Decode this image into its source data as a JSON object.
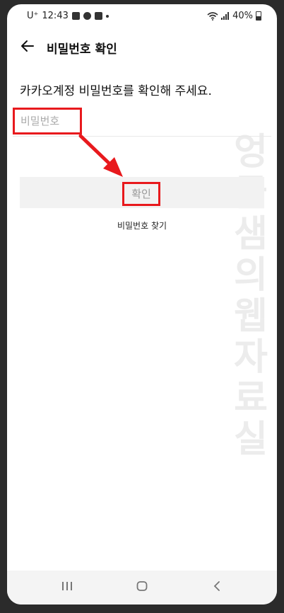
{
  "status_bar": {
    "carrier": "U⁺",
    "time": "12:43",
    "battery": "40%"
  },
  "header": {
    "title": "비밀번호 확인",
    "back_icon": "arrow-left-icon"
  },
  "prompt": "카카오계정 비밀번호를 확인해 주세요.",
  "password_field": {
    "placeholder": "비밀번호",
    "value": ""
  },
  "confirm_button": {
    "label": "확인"
  },
  "find_password_link": "비밀번호 찾기",
  "watermark": "엉클샘의웹자료실",
  "colors": {
    "highlight": "#e8191d",
    "button_bg": "#f2f2f2",
    "watermark": "#ececec"
  },
  "nav_bar": {
    "recents_icon": "recents-icon",
    "home_icon": "home-icon",
    "back_icon": "back-chevron-icon"
  }
}
